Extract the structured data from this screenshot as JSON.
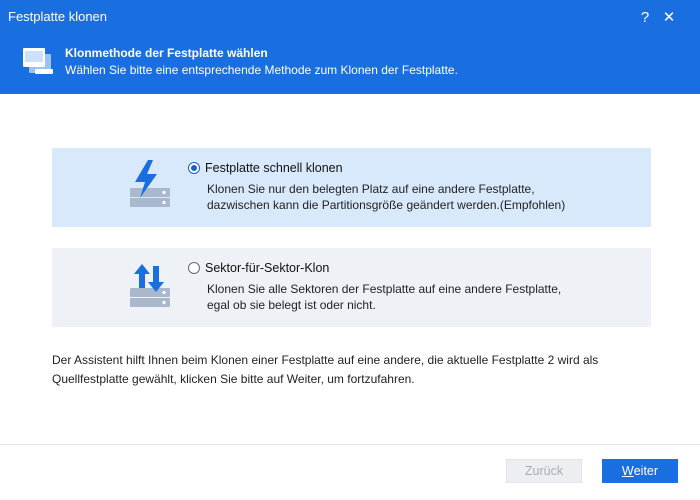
{
  "window": {
    "title": "Festplatte klonen",
    "help_label": "?",
    "close_label": "✕"
  },
  "header": {
    "title": "Klonmethode der Festplatte wählen",
    "subtitle": "Wählen Sie bitte eine entsprechende Methode zum Klonen der Festplatte."
  },
  "options": [
    {
      "label": "Festplatte schnell klonen",
      "selected": true,
      "description": "Klonen Sie nur den belegten Platz auf eine andere Festplatte, dazwischen kann die Partitionsgröße geändert werden.(Empfohlen)",
      "icon": "lightning-disk-icon"
    },
    {
      "label": "Sektor-für-Sektor-Klon",
      "selected": false,
      "description": "Klonen Sie alle Sektoren der Festplatte auf eine andere Festplatte, egal ob sie belegt ist oder nicht.",
      "icon": "transfer-arrows-disk-icon"
    }
  ],
  "info_text": "Der Assistent hilft Ihnen beim Klonen einer Festplatte auf eine andere, die aktuelle Festplatte 2 wird als Quellfestplatte gewählt, klicken Sie bitte auf Weiter, um fortzufahren.",
  "buttons": {
    "back_label": "Zurück",
    "next_first": "W",
    "next_rest": "eiter"
  },
  "colors": {
    "accent": "#1a6fe0",
    "selected_bg": "#d8e9fb",
    "option_bg": "#eef1f5"
  }
}
